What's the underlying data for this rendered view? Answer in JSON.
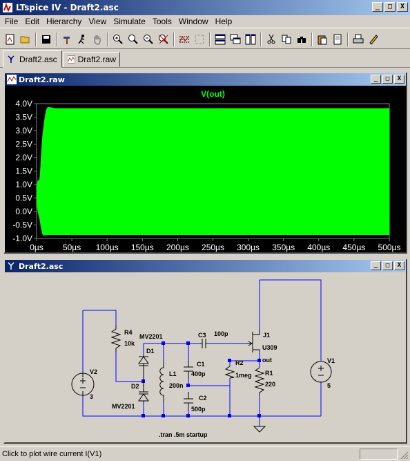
{
  "app": {
    "title": "LTspice IV - Draft2.asc"
  },
  "window_buttons": {
    "minimize": "_",
    "maximize": "□",
    "close": "X"
  },
  "menu": [
    "File",
    "Edit",
    "Hierarchy",
    "View",
    "Simulate",
    "Tools",
    "Window",
    "Help"
  ],
  "toolbar": [
    "new-schematic",
    "open",
    "save",
    "control-panel",
    "run",
    "halt",
    "zoom-in",
    "zoom-pan",
    "zoom-out",
    "zoom-fit",
    "autorange",
    "mark-unused",
    "tile-horizontal",
    "cascade",
    "tile-vertical",
    "cut",
    "copy",
    "find",
    "paste",
    "print-preview",
    "print",
    "draft"
  ],
  "tabs": [
    {
      "label": "Draft2.asc",
      "icon": "schematic-icon",
      "active": true
    },
    {
      "label": "Draft2.raw",
      "icon": "waveform-icon",
      "active": false
    }
  ],
  "plot_window": {
    "title": "Draft2.raw",
    "trace_label": "V(out)",
    "trace_color": "#00ff00",
    "background": "#000000"
  },
  "chart_data": {
    "type": "area",
    "title": "V(out)",
    "xlabel": "",
    "ylabel": "",
    "xlim": [
      0,
      500
    ],
    "ylim": [
      -1.0,
      4.0
    ],
    "x_ticks": [
      "0µs",
      "50µs",
      "100µs",
      "150µs",
      "200µs",
      "250µs",
      "300µs",
      "350µs",
      "400µs",
      "450µs",
      "500µs"
    ],
    "y_ticks": [
      "4.0V",
      "3.5V",
      "3.0V",
      "2.5V",
      "2.0V",
      "1.5V",
      "1.0V",
      "0.5V",
      "0.0V",
      "-0.5V",
      "-1.0V"
    ],
    "series": [
      {
        "name": "V(out)",
        "x_unit": "µs",
        "envelope_x": [
          0,
          1,
          2,
          3,
          4,
          5,
          6,
          7,
          8,
          9,
          10,
          11,
          12,
          13,
          14,
          15,
          16,
          18,
          20,
          22,
          24,
          26,
          28,
          30,
          35,
          40,
          60,
          100,
          200,
          300,
          400,
          500
        ],
        "upper": [
          0.5,
          1.0,
          1.15,
          1.15,
          1.1,
          1.3,
          1.7,
          2.2,
          2.6,
          2.9,
          3.1,
          3.3,
          3.5,
          3.65,
          3.75,
          3.82,
          3.86,
          3.86,
          3.85,
          3.84,
          3.83,
          3.82,
          3.82,
          3.82,
          3.82,
          3.82,
          3.82,
          3.82,
          3.82,
          3.82,
          3.82,
          3.82
        ],
        "lower": [
          0.5,
          0.2,
          0.0,
          -0.1,
          -0.2,
          -0.35,
          -0.5,
          -0.65,
          -0.78,
          -0.85,
          -0.88,
          -0.88,
          -0.87,
          -0.86,
          -0.86,
          -0.86,
          -0.86,
          -0.86,
          -0.86,
          -0.86,
          -0.86,
          -0.86,
          -0.86,
          -0.86,
          -0.86,
          -0.86,
          -0.86,
          -0.86,
          -0.86,
          -0.86,
          -0.86,
          -0.86
        ]
      }
    ]
  },
  "schematic_window": {
    "title": "Draft2.asc",
    "components": {
      "R4": {
        "ref": "R4",
        "value": "10k"
      },
      "V2": {
        "ref": "V2",
        "value": "3"
      },
      "D1": {
        "ref": "D1",
        "model": "MV2201"
      },
      "D2": {
        "ref": "D2",
        "model": "MV2201"
      },
      "L1": {
        "ref": "L1",
        "value": "200n"
      },
      "C1": {
        "ref": "C1",
        "value": "400p"
      },
      "C2": {
        "ref": "C2",
        "value": "500p"
      },
      "C3": {
        "ref": "C3",
        "value": "100p"
      },
      "R2": {
        "ref": "R2",
        "value": "1meg"
      },
      "J1": {
        "ref": "J1",
        "model": "U309"
      },
      "R1": {
        "ref": "R1",
        "value": "220"
      },
      "V1": {
        "ref": "V1",
        "value": "5"
      }
    },
    "net_label": "out",
    "directive": ".tran .5m startup",
    "wire_color": "#0000ff",
    "junction_color": "#0000ff",
    "background": "#d4d0c8"
  },
  "status": {
    "text": "Click to plot wire current I(V1)"
  }
}
